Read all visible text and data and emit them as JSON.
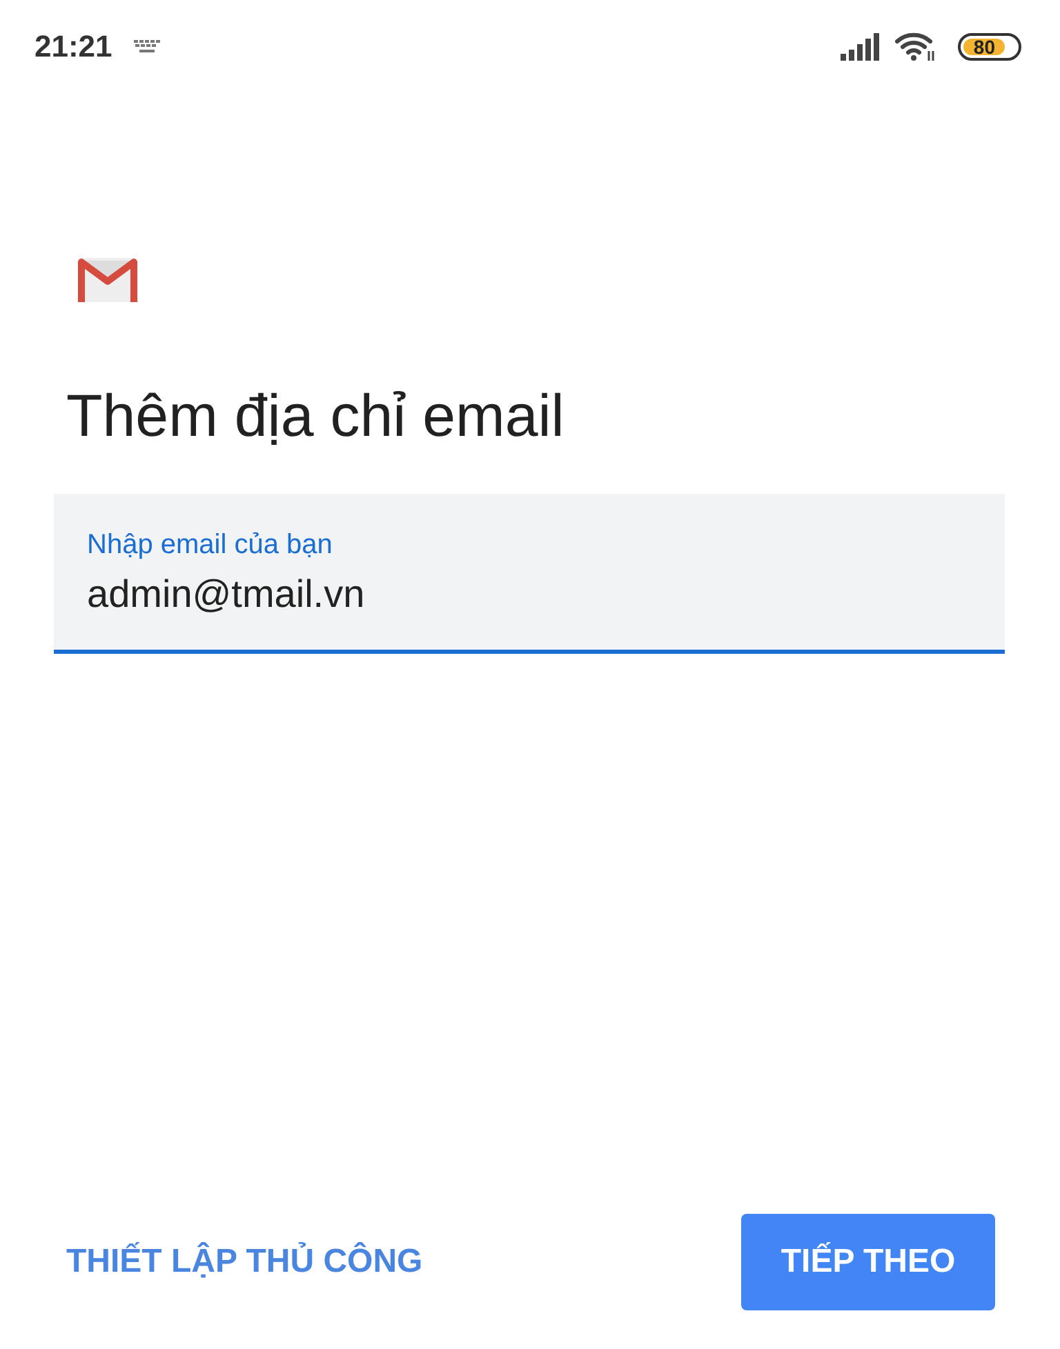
{
  "status_bar": {
    "time": "21:21",
    "battery": "80"
  },
  "title": "Thêm địa chỉ email",
  "email_field": {
    "label": "Nhập email của bạn",
    "value": "admin@tmail.vn",
    "focused": true
  },
  "buttons": [
    {
      "label": "THIẾT LẬP THỦ CÔNG",
      "kind": "text"
    },
    {
      "label": "TIẾP THEO",
      "kind": "filled"
    }
  ]
}
